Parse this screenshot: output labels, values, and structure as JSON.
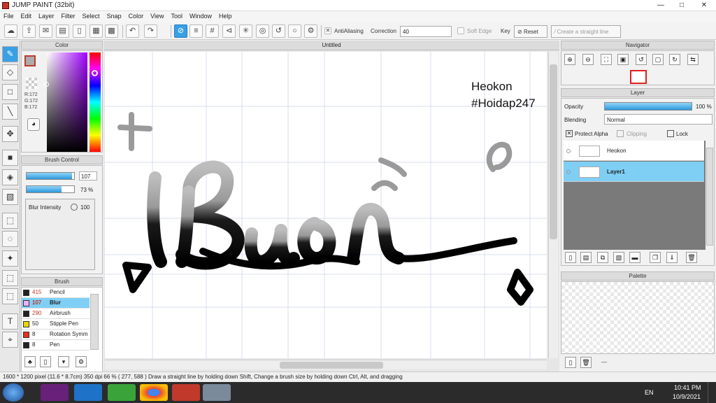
{
  "window": {
    "title": "JUMP PAINT (32bit)",
    "minimize": "—",
    "maximize": "□",
    "close": "✕"
  },
  "menu": [
    "File",
    "Edit",
    "Layer",
    "Filter",
    "Select",
    "Snap",
    "Color",
    "View",
    "Tool",
    "Window",
    "Help"
  ],
  "toolbar": {
    "antialiasing_label": "AntiAliasing",
    "correction_label": "Correction",
    "correction_value": "40",
    "soft_edge_label": "Soft Edge",
    "key_label": "Key",
    "reset_label": "Reset",
    "straight_line_label": "Create a straight line"
  },
  "color_panel": {
    "title": "Color",
    "r": "R:172",
    "g": "G:172",
    "b": "B:172",
    "fg_color": "#acacac"
  },
  "brush_control": {
    "title": "Brush Control",
    "size_value": "107",
    "size_fill": 0.95,
    "opacity_value": "73 %",
    "opacity_fill": 0.73,
    "blur_label": "Blur Intensity",
    "blur_value": "100"
  },
  "brush_panel": {
    "title": "Brush",
    "items": [
      {
        "size": "415",
        "name": "Pencil",
        "color": "#222222"
      },
      {
        "size": "107",
        "name": "Blur",
        "color": "#f3b0f3"
      },
      {
        "size": "290",
        "name": "Airbrush",
        "color": "#222222"
      },
      {
        "size": "50",
        "name": "Stipple Pen",
        "color": "#e8d800"
      },
      {
        "size": "8",
        "name": "Rotation Symm",
        "color": "#e83020"
      },
      {
        "size": "8",
        "name": "Pen",
        "color": "#222222"
      }
    ]
  },
  "canvas": {
    "tab_title": "Untitled",
    "text_author": "Heokon",
    "text_tag": "#Hoidap247",
    "lettering": "Buồn"
  },
  "navigator": {
    "title": "Navigator"
  },
  "layer_panel": {
    "title": "Layer",
    "opacity_label": "Opacity",
    "opacity_value": "100 %",
    "blending_label": "Blending",
    "blending_value": "Normal",
    "protect_alpha": "Protect Alpha",
    "clipping": "Clipping",
    "lock": "Lock",
    "layers": [
      {
        "name": "Heokon"
      },
      {
        "name": "Layer1"
      }
    ]
  },
  "palette": {
    "title": "Palette",
    "footer": "---"
  },
  "status": {
    "text": "1600 * 1200 pixel   (11.6 * 8.7cm)   350 dpi   66 %    ( 277, 588 )    Draw a straight line by holding down Shift, Change a brush size by holding down Ctrl, Alt, and dragging"
  },
  "taskbar": {
    "lang": "EN",
    "time": "10:41 PM",
    "date": "10/9/2021"
  }
}
